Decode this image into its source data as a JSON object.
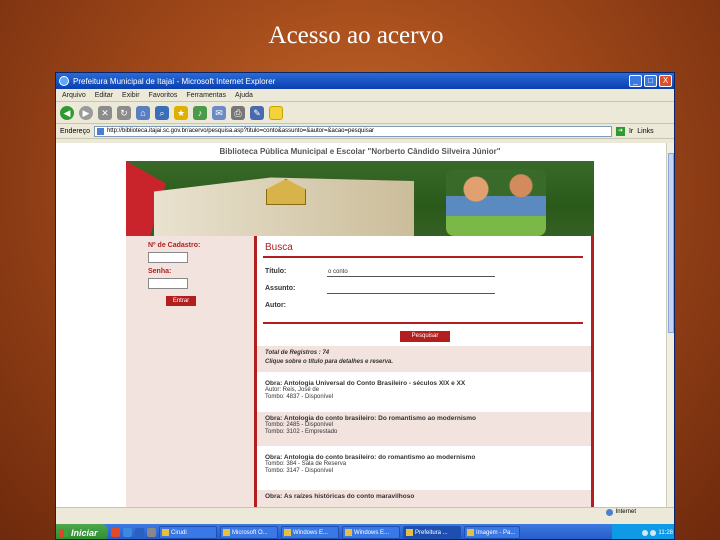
{
  "slide": {
    "title": "Acesso ao acervo"
  },
  "window": {
    "title": "Prefeitura Municipal de Itajaí - Microsoft Internet Explorer",
    "min_label": "_",
    "max_label": "□",
    "close_label": "X"
  },
  "menu": [
    "Arquivo",
    "Editar",
    "Exibir",
    "Favoritos",
    "Ferramentas",
    "Ajuda"
  ],
  "address": {
    "label": "Endereço",
    "url": "http://biblioteca.itajai.sc.gov.br/acervo/pesquisa.asp?titulo=conto&assunto=&autor=&acao=pesquisar",
    "go_label": "Ir",
    "links_label": "Links"
  },
  "site": {
    "header": "Biblioteca Pública Municipal e Escolar \"Norberto Cândido Silveira Júnior\"",
    "sidebar": {
      "cadastro_label": "Nº de Cadastro:",
      "senha_label": "Senha:",
      "login_button": "Entrar"
    },
    "search": {
      "title": "Busca",
      "titulo_label": "Título:",
      "titulo_value": "o conto",
      "assunto_label": "Assunto:",
      "autor_label": "Autor:",
      "button": "Pesquisar"
    },
    "summary": {
      "total": "Total de Registros : 74",
      "hint": "Clique sobre o título para detalhes e reserva."
    },
    "results": [
      {
        "title": "Obra: Antologia Universal do Conto Brasileiro - séculos XIX e XX",
        "lines": [
          "Autor: Reis, José de",
          "Tombo: 4837 - Disponível"
        ]
      },
      {
        "title": "Obra: Antologia do conto brasileiro: Do romantismo ao modernismo",
        "lines": [
          "Tombo: 2485 - Disponível",
          "Tombo: 3102 - Emprestado"
        ]
      },
      {
        "title": "Obra: Antologia do conto brasileiro: do romantismo ao modernismo",
        "lines": [
          "Tombo: 384 - Sala de Reserva",
          "Tombo: 3147 - Disponível"
        ]
      },
      {
        "title": "Obra: As raízes históricas do conto maravilhoso",
        "lines": []
      }
    ]
  },
  "statusbar": {
    "zone": "Internet"
  },
  "taskbar": {
    "start_label": "Iniciar",
    "tasks": [
      "Cirudi",
      "Microsoft O...",
      "Windows E...",
      "Windows E...",
      "Prefeitura ...",
      "Imagem - Pa..."
    ],
    "active_index": 4,
    "clock": "11:28"
  }
}
